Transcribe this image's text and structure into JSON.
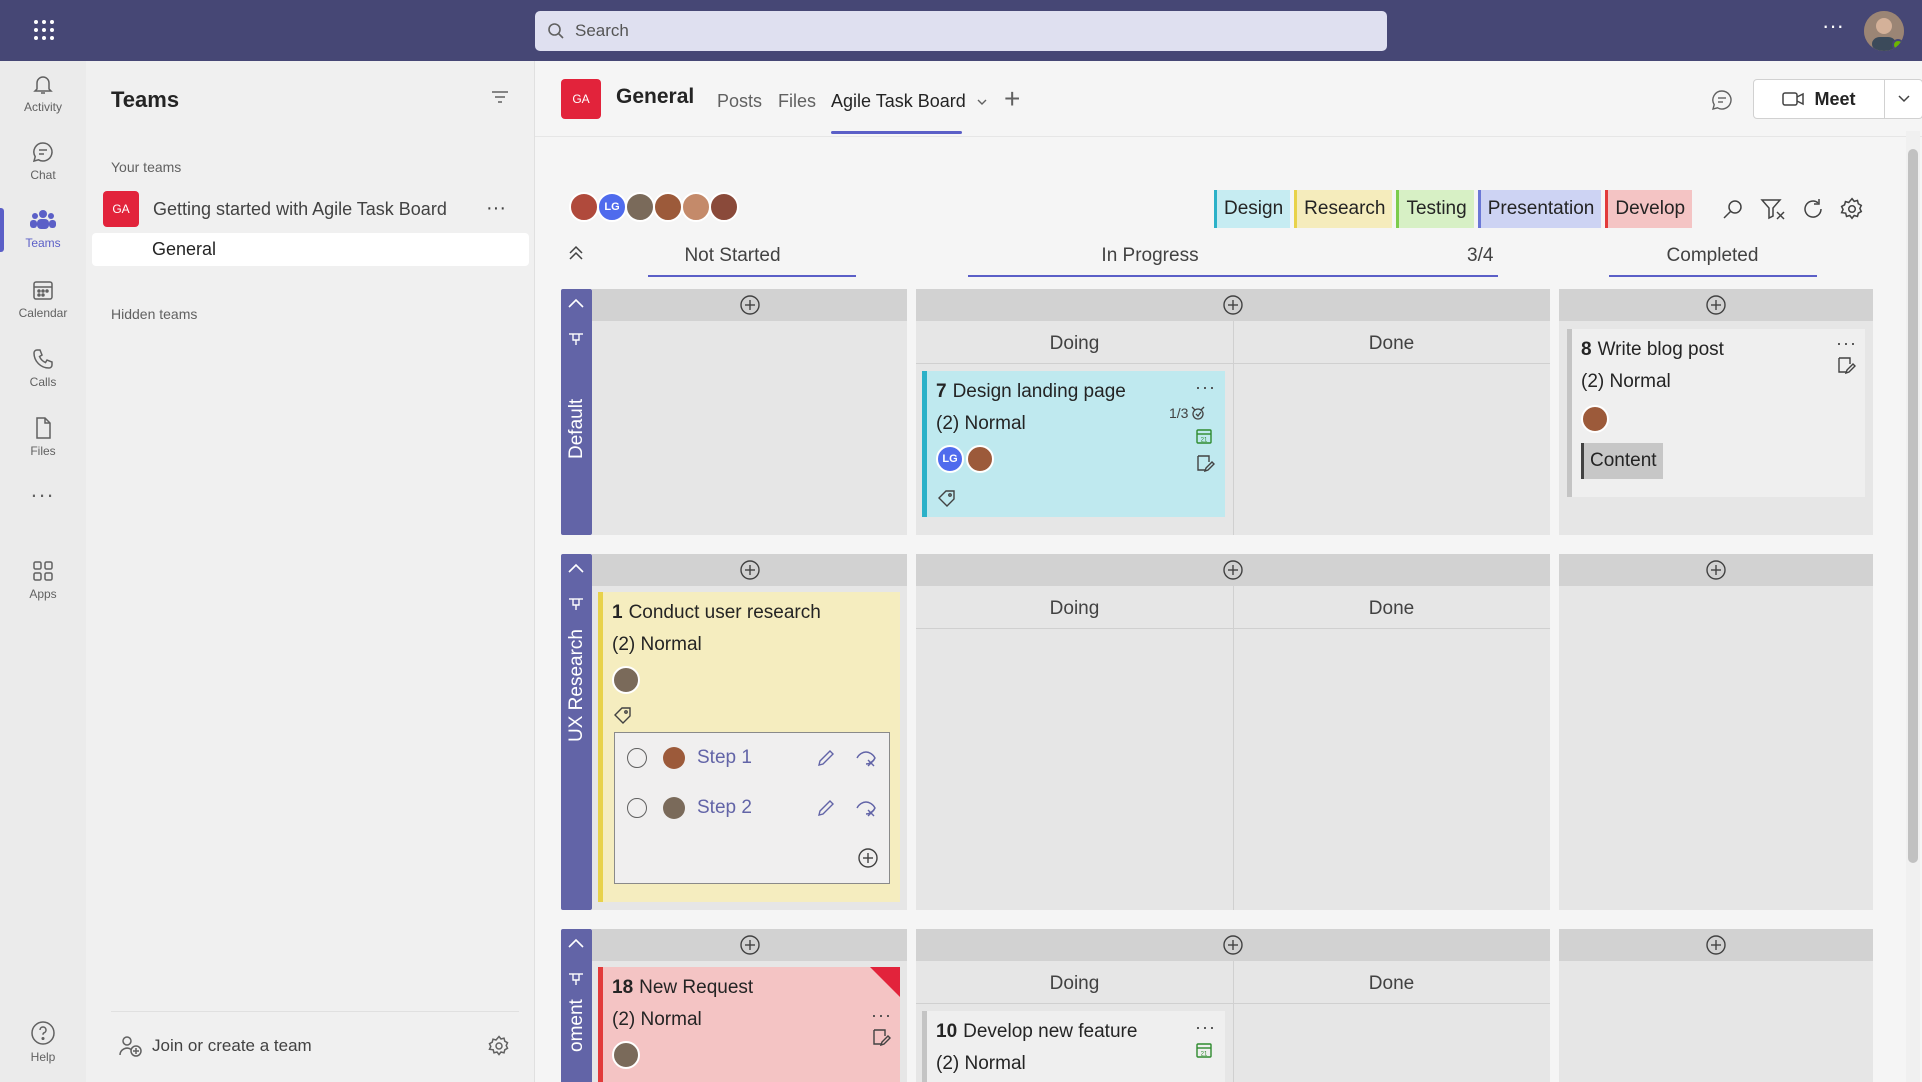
{
  "search": {
    "placeholder": "Search"
  },
  "rail": [
    {
      "label": "Activity",
      "icon": "bell-icon"
    },
    {
      "label": "Chat",
      "icon": "chat-icon"
    },
    {
      "label": "Teams",
      "icon": "teams-icon",
      "active": true
    },
    {
      "label": "Calendar",
      "icon": "calendar-icon"
    },
    {
      "label": "Calls",
      "icon": "phone-icon"
    },
    {
      "label": "Files",
      "icon": "file-icon"
    },
    {
      "label": "...",
      "icon": "more-icon"
    },
    {
      "label": "Apps",
      "icon": "apps-icon"
    },
    {
      "label": "Help",
      "icon": "help-icon"
    }
  ],
  "pane": {
    "title": "Teams",
    "your_teams": "Your teams",
    "team": {
      "initials": "GA",
      "name": "Getting started with Agile Task Board"
    },
    "channel": "General",
    "hidden_teams": "Hidden teams",
    "join": "Join or create a team"
  },
  "header": {
    "initials": "GA",
    "title": "General",
    "tabs": [
      "Posts",
      "Files",
      "Agile Task Board"
    ],
    "meet": "Meet"
  },
  "board": {
    "avatars": [
      {
        "initials": "",
        "color": "#b04a3c"
      },
      {
        "initials": "LG",
        "color": "#4f6bed"
      },
      {
        "initials": "",
        "color": "#7a6a5a"
      },
      {
        "initials": "",
        "color": "#9c5a3a"
      },
      {
        "initials": "",
        "color": "#c48a6a"
      },
      {
        "initials": "",
        "color": "#8a4a3a"
      }
    ],
    "tags": [
      {
        "label": "Design",
        "bg": "#c6ecf2",
        "border": "#2bb1c8"
      },
      {
        "label": "Research",
        "bg": "#f5ecbc",
        "border": "#e8d24a"
      },
      {
        "label": "Testing",
        "bg": "#d7f0c5",
        "border": "#7ccc4e"
      },
      {
        "label": "Presentation",
        "bg": "#cdd3f3",
        "border": "#6a77d6"
      },
      {
        "label": "Develop",
        "bg": "#f4c4c4",
        "border": "#e23a3a"
      }
    ],
    "columns": {
      "not_started": "Not Started",
      "in_progress": "In Progress",
      "wip": "3/4",
      "completed": "Completed",
      "doing": "Doing",
      "done": "Done"
    },
    "lanes": [
      {
        "name": "Default"
      },
      {
        "name": "UX Research"
      },
      {
        "name": "oment"
      }
    ],
    "cards": {
      "c7": {
        "num": "7",
        "title": "Design landing page",
        "priority": "(2) Normal",
        "check": "1/3",
        "avatar": "LG"
      },
      "c8": {
        "num": "8",
        "title": "Write blog post",
        "priority": "(2) Normal",
        "chip": "Content"
      },
      "c1": {
        "num": "1",
        "title": "Conduct user research",
        "priority": "(2) Normal",
        "steps": [
          "Step 1",
          "Step 2"
        ]
      },
      "c18": {
        "num": "18",
        "title": "New Request",
        "priority": "(2) Normal"
      },
      "c10": {
        "num": "10",
        "title": "Develop new feature",
        "priority": "(2) Normal"
      }
    }
  }
}
